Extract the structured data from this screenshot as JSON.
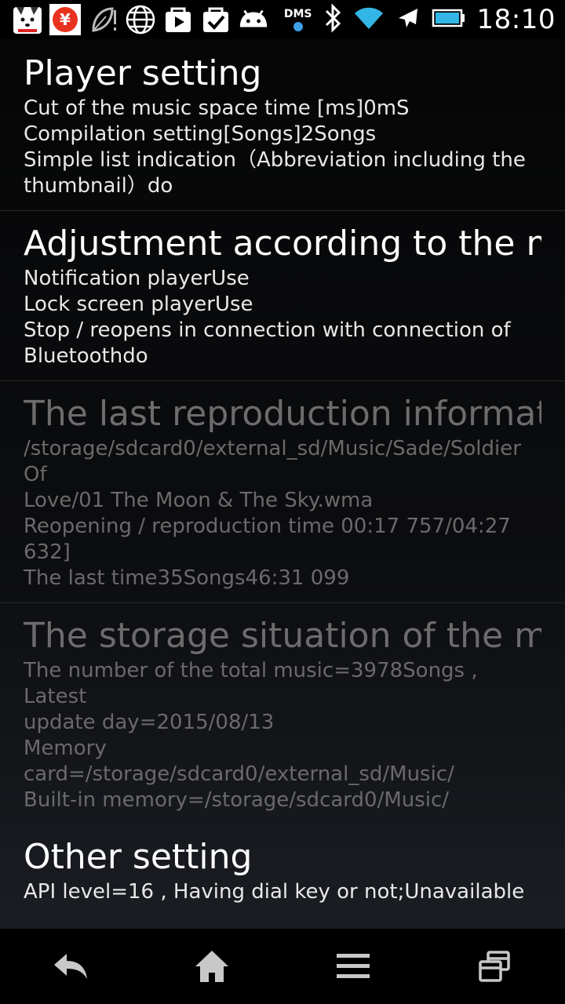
{
  "status_bar": {
    "icons": [
      "dog-mascot-icon",
      "yen-app-icon",
      "leaf-icon",
      "globe-icon",
      "play-store-icon",
      "task-check-icon",
      "android-icon"
    ],
    "dms_label": "DMS",
    "right_icons": [
      "bluetooth-icon",
      "wifi-icon",
      "airplane-icon",
      "battery-icon"
    ],
    "time": "18:10"
  },
  "sections": [
    {
      "title": "Player setting",
      "lines": [
        "Cut of the music space time [ms]0mS",
        "Compilation setting[Songs]2Songs",
        "Simple list indication（Abbreviation including the",
        "thumbnail）do"
      ]
    },
    {
      "title": "Adjustment according to the mode",
      "lines": [
        "Notification playerUse",
        "Lock screen playerUse",
        "Stop / reopens in connection with connection of",
        "Bluetoothdo"
      ]
    },
    {
      "title": "The last reproduction information",
      "lines": [
        "/storage/sdcard0/external_sd/Music/Sade/Soldier Of",
        "Love/01 The Moon & The Sky.wma",
        "Reopening / reproduction time 00:17 757/04:27 632]",
        "The last time35Songs46:31 099"
      ]
    },
    {
      "title": "The storage situation of the music",
      "lines": [
        "The number of the total music=3978Songs , Latest",
        "update day=2015/08/13",
        "Memory card=/storage/sdcard0/external_sd/Music/",
        "Built-in memory=/storage/sdcard0/Music/"
      ]
    },
    {
      "title": "Other setting",
      "lines": [
        "API level=16 , Having dial key or not;Unavailable"
      ]
    }
  ],
  "nav_bar": {
    "icons": [
      "back-icon",
      "home-icon",
      "menu-icon",
      "recent-apps-icon"
    ]
  }
}
